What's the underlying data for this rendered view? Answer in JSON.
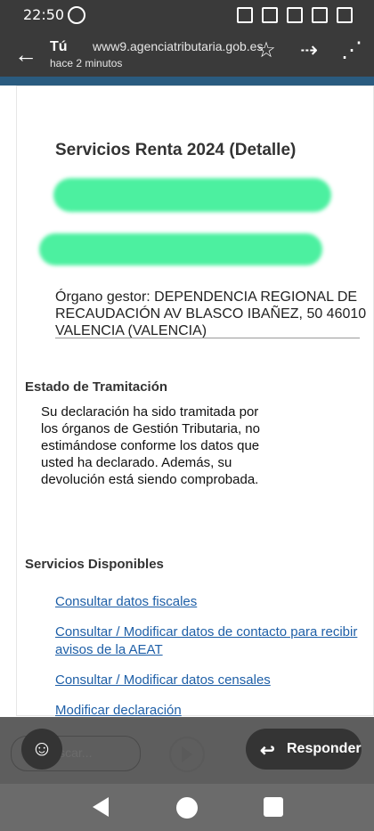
{
  "status_bar": {
    "time": "22:50"
  },
  "browser": {
    "title": "Tú",
    "url": "www9.agenciatributaria.gob.es",
    "time_ago": "hace 2 minutos"
  },
  "main": {
    "title": "Servicios Renta 2024 (Detalle)",
    "organo_gestor": "Órgano gestor: DEPENDENCIA REGIONAL DE RECAUDACIÓN  AV BLASCO IBAÑEZ, 50 46010 VALENCIA (VALENCIA)",
    "estado_title": "Estado de Tramitación",
    "estado_text": "Su declaración ha sido tramitada por los órganos de Gestión Tributaria, no estimándose conforme los datos que usted ha declarado. Además, su devolución está siendo comprobada.",
    "servicios_title": "Servicios Disponibles",
    "links": [
      "Consultar datos fiscales",
      "Consultar / Modificar datos de contacto para recibir avisos de la AEAT",
      "Consultar / Modificar datos censales",
      "Modificar declaración"
    ]
  },
  "bottom": {
    "search_placeholder": "Buscar...",
    "reply_label": "Responder"
  }
}
